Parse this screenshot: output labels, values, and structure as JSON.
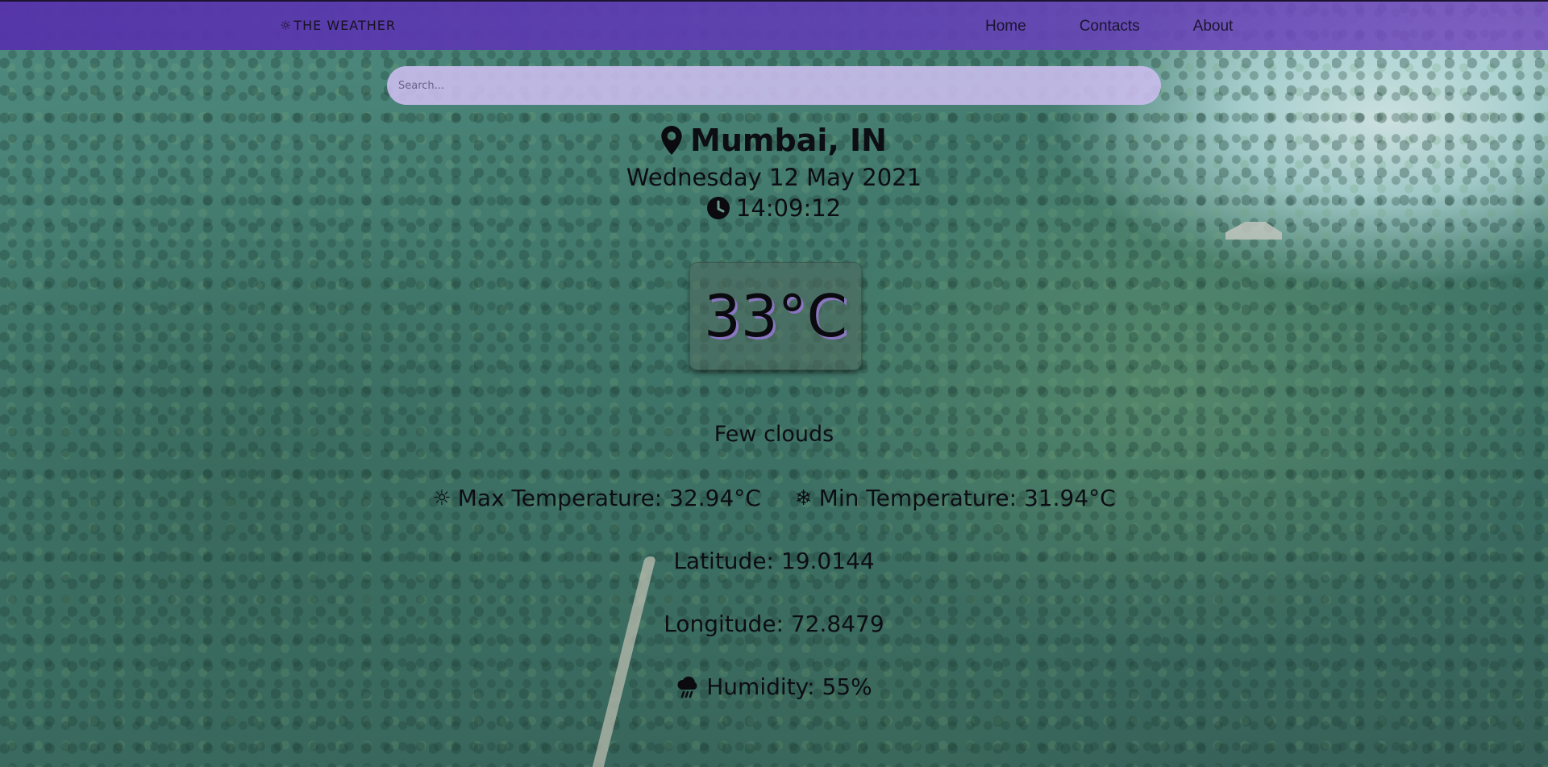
{
  "navbar": {
    "brand_icon": "sun-icon",
    "brand_glyph": "☼",
    "brand": "THE WEATHER",
    "links": [
      {
        "label": "Home"
      },
      {
        "label": "Contacts"
      },
      {
        "label": "About"
      }
    ]
  },
  "search": {
    "placeholder": "Search...",
    "value": ""
  },
  "location": {
    "icon": "map-pin-icon",
    "city": "Mumbai, IN"
  },
  "date": "Wednesday 12 May 2021",
  "time": {
    "icon": "clock-icon",
    "value": "14:09:12"
  },
  "temperature": "33°C",
  "description": "Few clouds",
  "max_temp": {
    "icon": "sun-icon",
    "glyph": "☼",
    "label": "Max Temperature: 32.94°C"
  },
  "min_temp": {
    "icon": "snowflake-icon",
    "glyph": "❄",
    "label": "Min Temperature: 31.94°C"
  },
  "latitude": "Latitude: 19.0144",
  "longitude": "Longitude: 72.8479",
  "humidity": {
    "icon": "rain-cloud-icon",
    "label": "Humidity: 55%"
  },
  "colors": {
    "navbar": "#5a38b0",
    "search_bg": "#cdbef0",
    "temp_shadow": "#9678d2"
  }
}
